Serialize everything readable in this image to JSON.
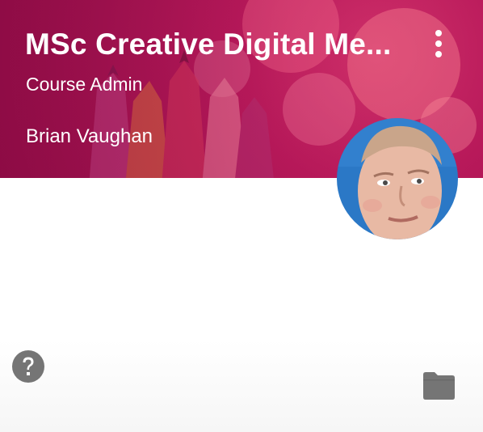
{
  "course": {
    "title": "MSc Creative Digital Me...",
    "section": "Course Admin",
    "teacher": "Brian Vaughan"
  },
  "colors": {
    "banner": "#a0124e",
    "text_on_banner": "#ffffff",
    "icon_gray": "#757575"
  },
  "icons": {
    "menu": "more-vert-icon",
    "help": "help-icon",
    "folder": "folder-icon"
  }
}
